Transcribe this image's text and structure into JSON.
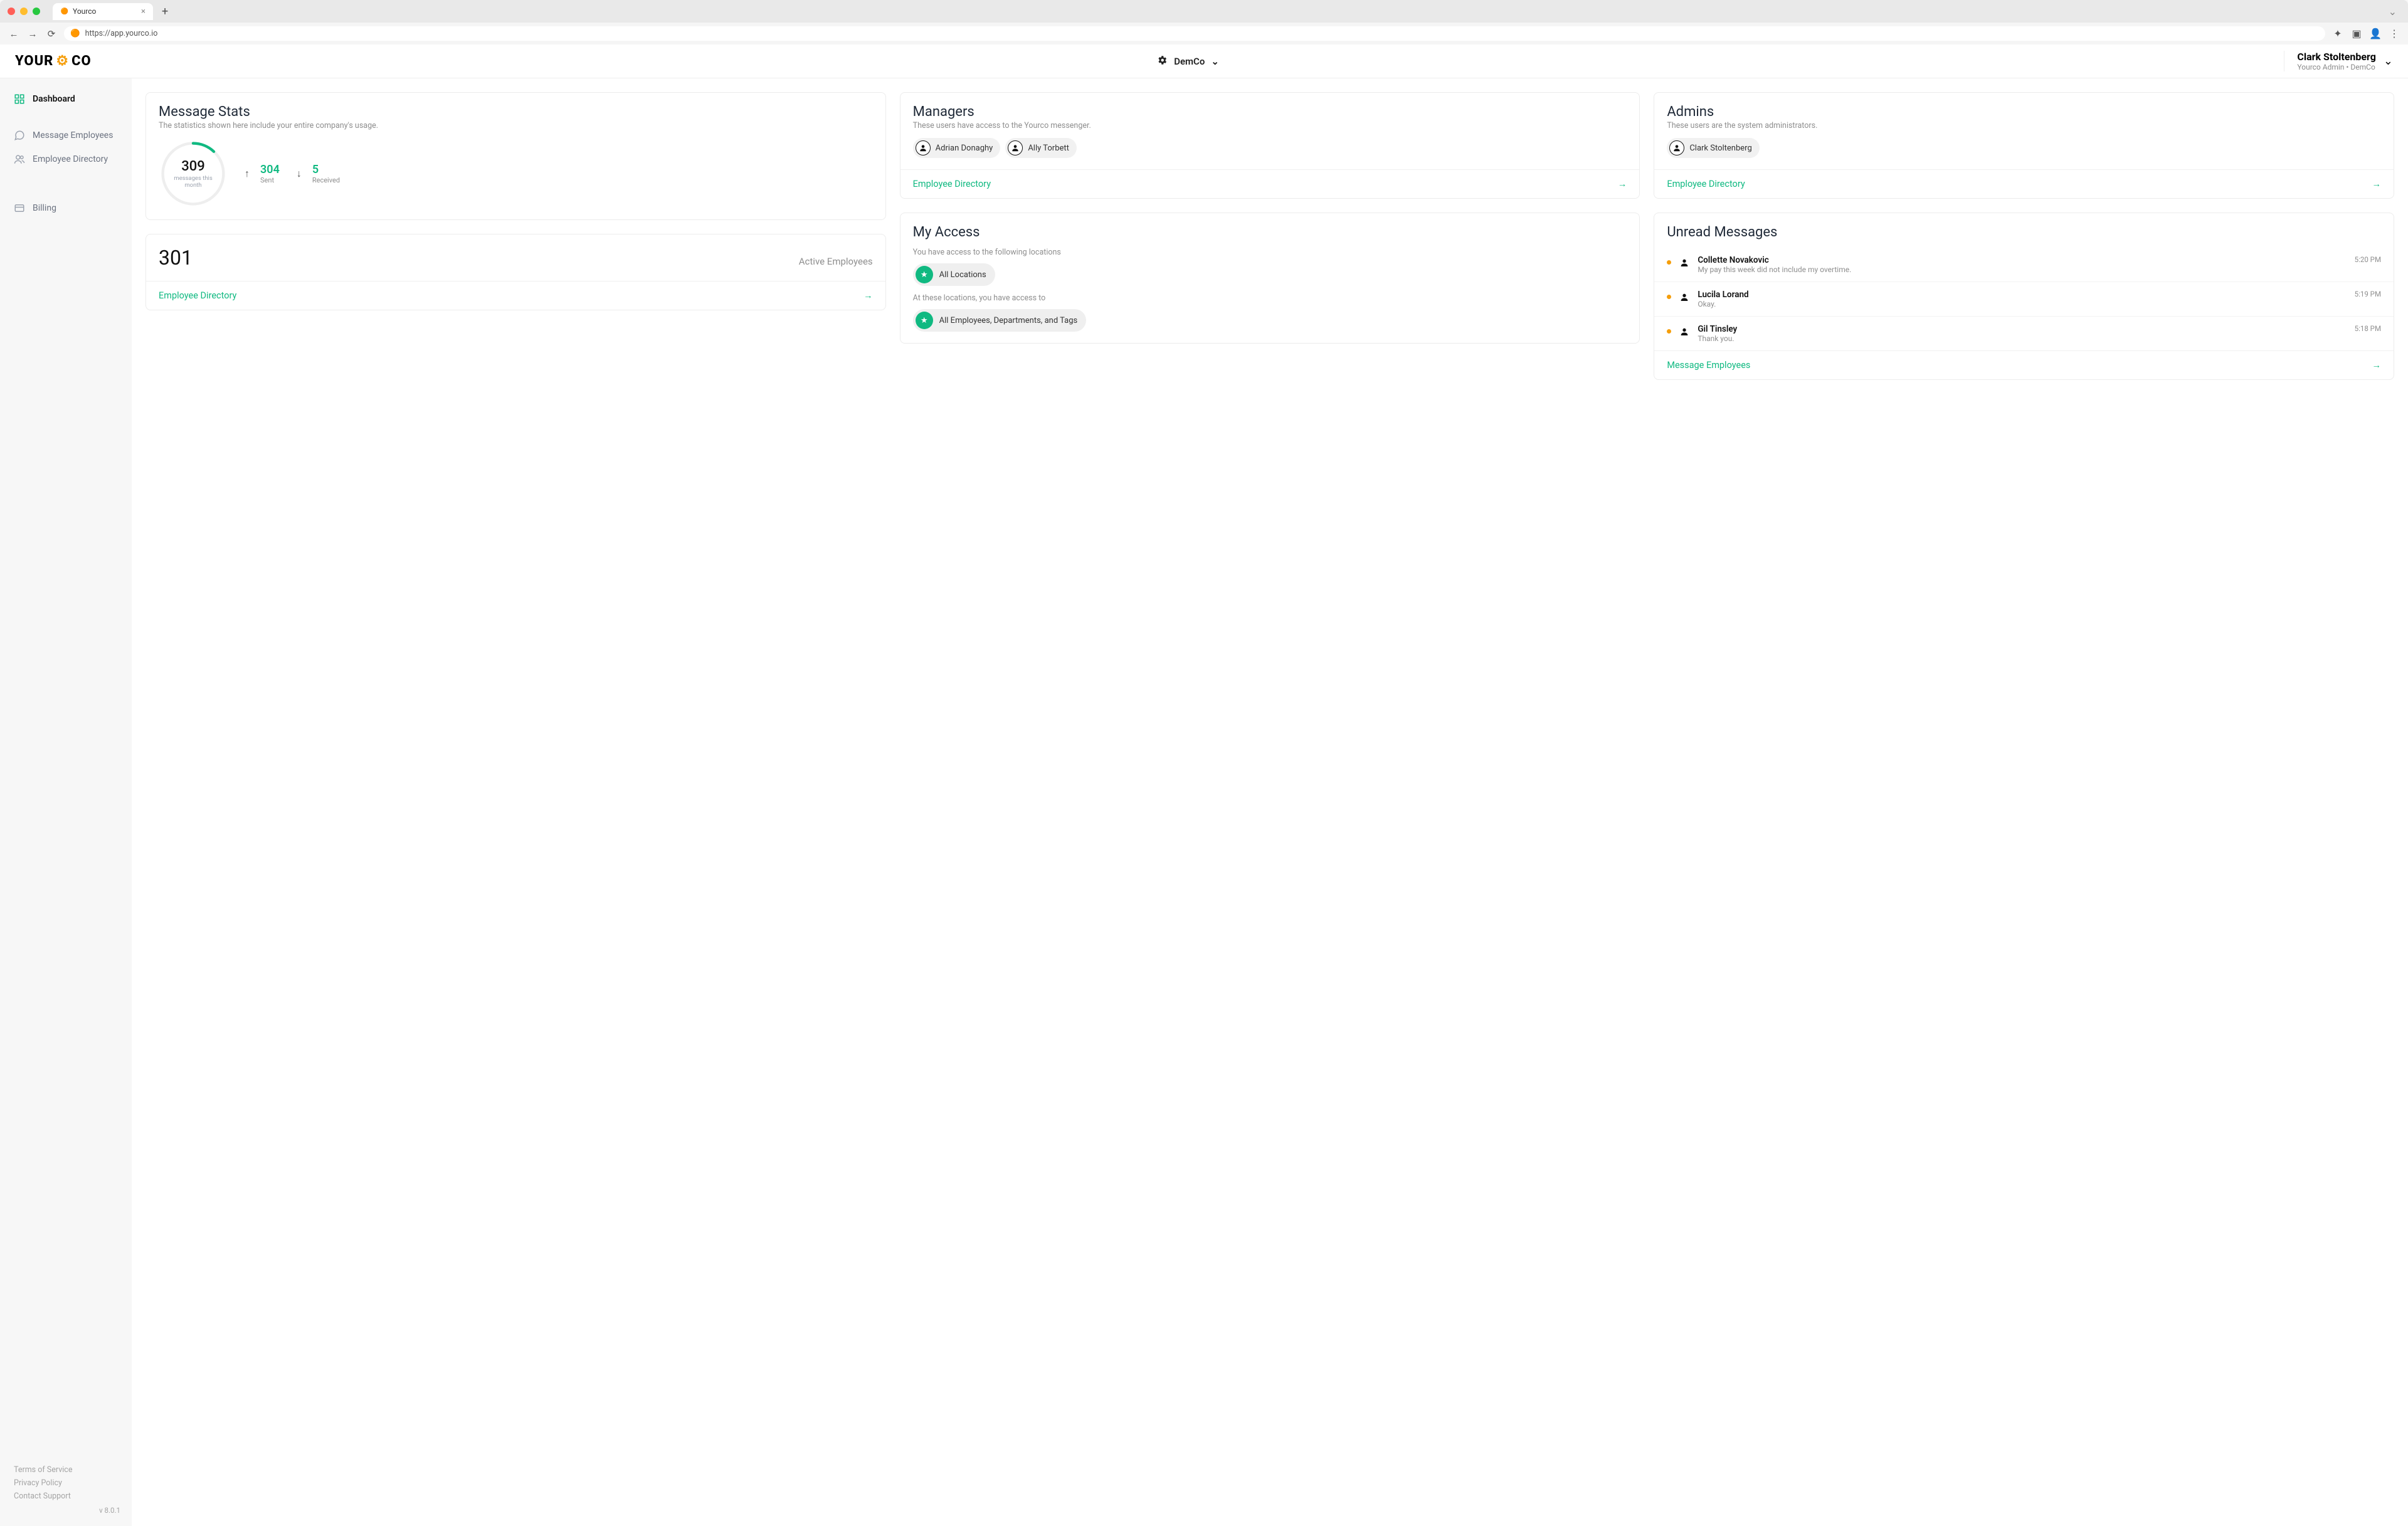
{
  "browser": {
    "tab_title": "Yourco",
    "url": "https://app.yourco.io"
  },
  "header": {
    "logo_part1": "YOUR",
    "logo_part2": "CO",
    "org_name": "DemCo",
    "user_name": "Clark Stoltenberg",
    "user_subtitle": "Yourco Admin • DemCo"
  },
  "sidebar": {
    "items": [
      {
        "label": "Dashboard",
        "active": true
      },
      {
        "label": "Message Employees",
        "active": false
      },
      {
        "label": "Employee Directory",
        "active": false
      },
      {
        "label": "Billing",
        "active": false
      }
    ],
    "footer": {
      "tos": "Terms of Service",
      "privacy": "Privacy Policy",
      "support": "Contact Support",
      "version": "v 8.0.1"
    }
  },
  "cards": {
    "message_stats": {
      "title": "Message Stats",
      "subtitle": "The statistics shown here include your entire company's usage.",
      "ring_value": "309",
      "ring_label": "messages this month",
      "sent_value": "304",
      "sent_label": "Sent",
      "recv_value": "5",
      "recv_label": "Received"
    },
    "active_employees": {
      "count": "301",
      "label": "Active Employees",
      "link": "Employee Directory"
    },
    "managers": {
      "title": "Managers",
      "subtitle": "These users have access to the Yourco messenger.",
      "people": [
        {
          "name": "Adrian Donaghy"
        },
        {
          "name": "Ally Torbett"
        }
      ],
      "link": "Employee Directory"
    },
    "my_access": {
      "title": "My Access",
      "subtitle1": "You have access to the following locations",
      "pill1": "All Locations",
      "subtitle2": "At these locations, you have access to",
      "pill2": "All Employees, Departments, and Tags"
    },
    "admins": {
      "title": "Admins",
      "subtitle": "These users are the system administrators.",
      "people": [
        {
          "name": "Clark Stoltenberg"
        }
      ],
      "link": "Employee Directory"
    },
    "unread": {
      "title": "Unread Messages",
      "messages": [
        {
          "name": "Collette Novakovic",
          "preview": "My pay this week did not include my overtime.",
          "time": "5:20 PM"
        },
        {
          "name": "Lucila Lorand",
          "preview": "Okay.",
          "time": "5:19 PM"
        },
        {
          "name": "Gil Tinsley",
          "preview": "Thank you.",
          "time": "5:18 PM"
        }
      ],
      "link": "Message Employees"
    }
  }
}
